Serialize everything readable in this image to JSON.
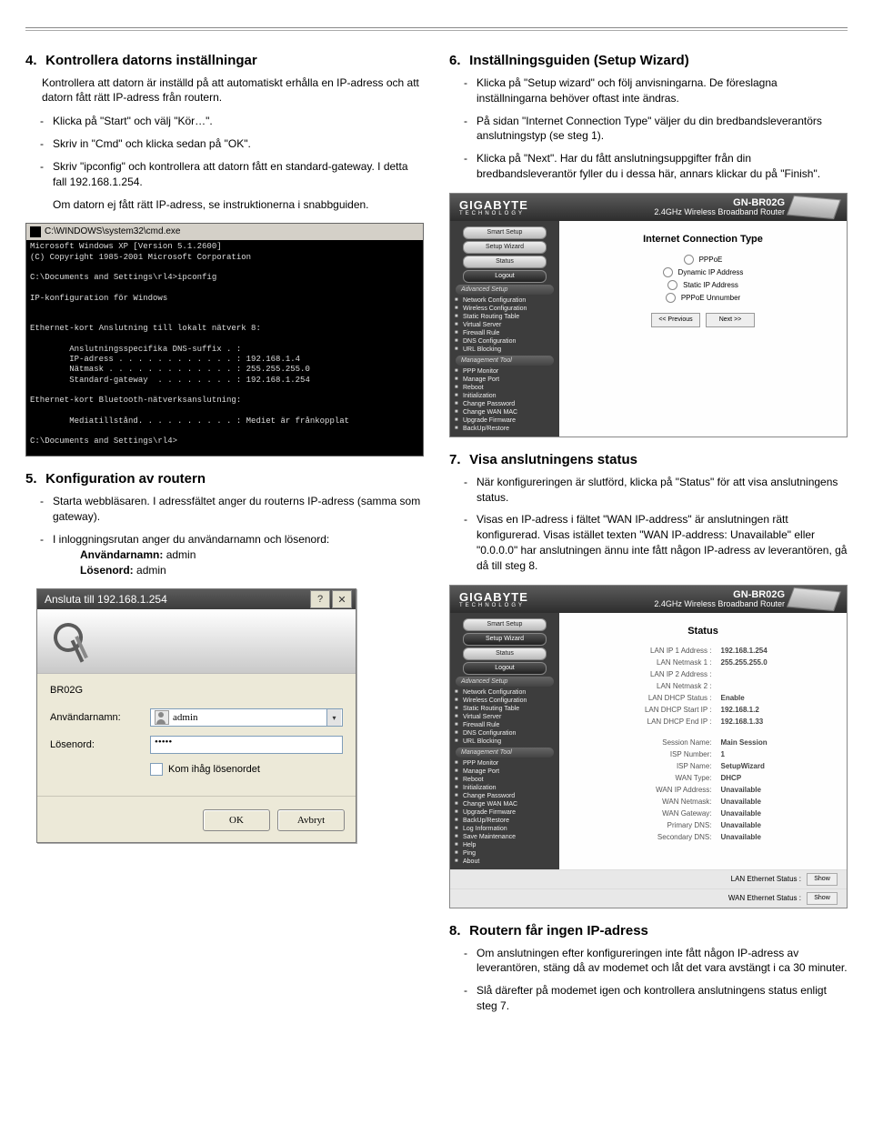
{
  "left": {
    "sec4": {
      "num": "4.",
      "title": "Kontrollera datorns inställningar",
      "lead": "Kontrollera att datorn är inställd på att automatiskt erhålla en IP-adress och att datorn fått rätt IP-adress från routern.",
      "items": [
        "Klicka på \"Start\" och välj \"Kör…\".",
        "Skriv in \"Cmd\" och klicka sedan på \"OK\".",
        "Skriv \"ipconfig\" och kontrollera att datorn fått en standard-gateway. I detta fall 192.168.1.254.",
        "Om datorn ej fått rätt IP-adress, se instruktionerna i snabbguiden."
      ],
      "item3_plain": true
    },
    "cmd": {
      "title": "C:\\WINDOWS\\system32\\cmd.exe",
      "body": "Microsoft Windows XP [Version 5.1.2600]\n(C) Copyright 1985-2001 Microsoft Corporation\n\nC:\\Documents and Settings\\rl4>ipconfig\n\nIP-konfiguration för Windows\n\n\nEthernet-kort Anslutning till lokalt nätverk 8:\n\n        Anslutningsspecifika DNS-suffix . :\n        IP-adress . . . . . . . . . . . . : 192.168.1.4\n        Nätmask . . . . . . . . . . . . . : 255.255.255.0\n        Standard-gateway  . . . . . . . . : 192.168.1.254\n\nEthernet-kort Bluetooth-nätverksanslutning:\n\n        Mediatillstånd. . . . . . . . . . : Mediet är frånkopplat\n\nC:\\Documents and Settings\\rl4>"
    },
    "sec5": {
      "num": "5.",
      "title": "Konfiguration av routern",
      "items": [
        "Starta webbläsaren. I adressfältet anger du routerns IP-adress (samma som gateway).",
        "I inloggningsrutan anger du användarnamn och lösenord:"
      ],
      "user_label": "Användarnamn:",
      "user_val": "admin",
      "pass_label": "Lösenord:",
      "pass_val": "admin"
    },
    "dlg": {
      "title": "Ansluta till 192.168.1.254",
      "sitename": "BR02G",
      "user_label": "Användarnamn:",
      "user_value": "admin",
      "pass_label": "Lösenord:",
      "pass_value": "•••••",
      "remember": "Kom ihåg lösenordet",
      "ok": "OK",
      "cancel": "Avbryt"
    }
  },
  "right": {
    "sec6": {
      "num": "6.",
      "title": "Inställningsguiden (Setup Wizard)",
      "items": [
        "Klicka på \"Setup wizard\" och följ anvisningarna. De föreslagna inställningarna behöver oftast inte ändras.",
        "På sidan \"Internet Connection Type\" väljer du din bredbandsleverantörs anslutningstyp (se steg 1).",
        "Klicka på \"Next\". Har du fått anslutningsuppgifter från din bredbandsleverantör fyller du i dessa här, annars klickar du på \"Finish\"."
      ]
    },
    "router": {
      "brand": "GIGABYTE",
      "brand_sub": "TECHNOLOGY",
      "model": "GN-BR02G",
      "model_sub": "2.4GHz Wireless Broadband Router",
      "side_pills": [
        "Smart Setup",
        "Setup Wizard",
        "Status",
        "Logout"
      ],
      "side_hdr1": "Advanced Setup",
      "side_items1": [
        "Network Configuration",
        "Wireless Configuration",
        "Static Routing Table",
        "Virtual Server",
        "Firewall Rule",
        "DNS Configuration",
        "URL Blocking"
      ],
      "side_hdr2": "Management Tool",
      "side_items2": [
        "PPP Monitor",
        "Manage Port",
        "Reboot",
        "Initialization",
        "Change Password",
        "Change WAN MAC",
        "Upgrade Firmware",
        "BackUp/Restore"
      ],
      "side_items2b": [
        "Log Information",
        "Save Maintenance",
        "Help",
        "Ping",
        "About"
      ],
      "ict_title": "Internet Connection Type",
      "ict_options": [
        "PPPoE",
        "Dynamic IP Address",
        "Static IP Address",
        "PPPoE Unnumber"
      ],
      "prev": "<< Previous",
      "next": "Next >>"
    },
    "sec7": {
      "num": "7.",
      "title": "Visa anslutningens status",
      "items": [
        "När konfigureringen är slutförd, klicka på \"Status\" för att visa anslutningens status.",
        "Visas en IP-adress i fältet \"WAN IP-address\" är anslutningen rätt konfigurerad. Visas istället texten \"WAN IP-address: Unavailable\" eller \"0.0.0.0\" har anslutningen ännu inte fått någon IP-adress av leverantören, gå då till steg 8."
      ]
    },
    "status": {
      "title": "Status",
      "rows": [
        [
          "LAN IP 1 Address :",
          "192.168.1.254"
        ],
        [
          "LAN Netmask 1 :",
          "255.255.255.0"
        ],
        [
          "LAN IP 2 Address :",
          ""
        ],
        [
          "LAN Netmask 2 :",
          ""
        ],
        [
          "LAN DHCP Status :",
          "Enable"
        ],
        [
          "LAN DHCP Start IP :",
          "192.168.1.2"
        ],
        [
          "LAN DHCP End IP :",
          "192.168.1.33"
        ]
      ],
      "rows2": [
        [
          "Session Name:",
          "Main Session"
        ],
        [
          "ISP Number:",
          "1"
        ],
        [
          "ISP Name:",
          "SetupWizard"
        ],
        [
          "WAN Type:",
          "DHCP"
        ],
        [
          "WAN IP Address:",
          "Unavailable"
        ],
        [
          "WAN Netmask:",
          "Unavailable"
        ],
        [
          "WAN Gateway:",
          "Unavailable"
        ],
        [
          "Primary DNS:",
          "Unavailable"
        ],
        [
          "Secondary DNS:",
          "Unavailable"
        ]
      ],
      "eth1_label": "LAN Ethernet Status :",
      "eth2_label": "WAN Ethernet Status :",
      "show": "Show"
    },
    "sec8": {
      "num": "8.",
      "title": "Routern får ingen IP-adress",
      "items": [
        "Om anslutningen efter konfigureringen inte fått någon IP-adress av leverantören, stäng då av modemet och låt det vara avstängt i ca 30 minuter.",
        "Slå därefter på modemet igen och kontrollera anslutningens status enligt steg 7."
      ]
    }
  }
}
